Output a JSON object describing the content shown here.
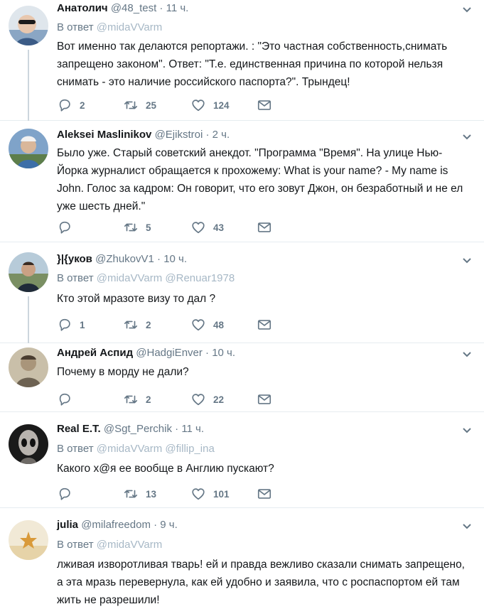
{
  "reply_prefix": "В ответ",
  "tweets": [
    {
      "name": "Анатолич",
      "handle": "@48_test",
      "time": "· 11 ч.",
      "reply_to": [
        "@midaVVarm"
      ],
      "text": "Вот именно так делаются репортажи. : \"Это частная собственность,снимать запрещено законом\". Ответ: \"Т.е. единственная причина по которой нельзя снимать - это наличие российского паспорта?\". Трындец!",
      "replies": "2",
      "retweets": "25",
      "likes": "124"
    },
    {
      "name": "Aleksei Maslinikov",
      "handle": "@Ejikstroi",
      "time": "· 2 ч.",
      "reply_to": [],
      "text": "Было уже. Старый советский анекдот. \"Программа \"Время\". На улице Нью-Йорка журналист обращается к прохожему: What is your name? - My name is John. Голос за кадром: Он говорит, что его зовут Джон, он безработный и не ел уже шесть дней.\"",
      "replies": "",
      "retweets": "5",
      "likes": "43"
    },
    {
      "name": "}|{yков",
      "handle": "@ZhukovV1",
      "time": "· 10 ч.",
      "reply_to": [
        "@midaVVarm",
        "@Renuar1978"
      ],
      "text": "Кто этой мразоте визу то дал ?",
      "replies": "1",
      "retweets": "2",
      "likes": "48"
    },
    {
      "name": "Андрей Аспид",
      "handle": "@HadgiEnver",
      "time": "· 10 ч.",
      "reply_to": [],
      "text": "Почему в морду не дали?",
      "replies": "",
      "retweets": "2",
      "likes": "22"
    },
    {
      "name": "Real E.T.",
      "handle": "@Sgt_Perchik",
      "time": "· 11 ч.",
      "reply_to": [
        "@midaVVarm",
        "@fillip_ina"
      ],
      "text": "Какого х@я ее вообще в Англию пускают?",
      "replies": "",
      "retweets": "13",
      "likes": "101"
    },
    {
      "name": "julia",
      "handle": "@milafreedom",
      "time": "· 9 ч.",
      "reply_to": [
        "@midaVVarm"
      ],
      "text": "лживая изворотливая тварь! ей и правда вежливо сказали снимать запрещено, а эта мразь перевернула, как ей удобно и заявила, что с роспаспортом ей там жить не разрешили!",
      "replies": "",
      "retweets": "",
      "likes": ""
    }
  ],
  "colors": {
    "text": "#14171a",
    "secondary": "#657786",
    "mention_faded": "#a7b8c6",
    "divider": "#e6ecf0"
  },
  "icons": [
    "reply-icon",
    "retweet-icon",
    "like-icon",
    "direct-message-icon",
    "chevron-down-icon"
  ]
}
